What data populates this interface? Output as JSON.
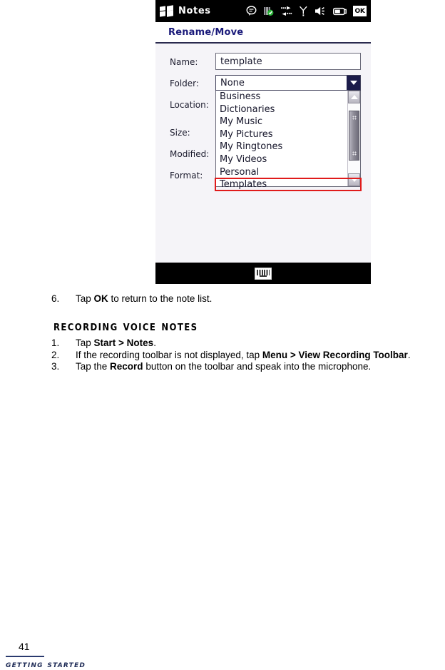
{
  "device": {
    "titlebar": {
      "logo": "windows-flag-logo",
      "app_name": "Notes",
      "icons": [
        {
          "name": "messaging-icon",
          "glyph": "speech-bubble"
        },
        {
          "name": "signal-bars-icon",
          "glyph": "bars-with-check"
        },
        {
          "name": "data-connection-icon",
          "glyph": "two-arrows"
        },
        {
          "name": "phone-signal-icon",
          "glyph": "antenna"
        },
        {
          "name": "volume-icon",
          "glyph": "speaker"
        },
        {
          "name": "battery-icon",
          "glyph": "battery"
        }
      ],
      "ok_label": "OK"
    },
    "page_title": "Rename/Move",
    "fields": [
      {
        "label": "Name:"
      },
      {
        "label": "Folder:"
      },
      {
        "label": "Location:"
      },
      {
        "label": "Size:"
      },
      {
        "label": "Modified:"
      },
      {
        "label": "Format:"
      }
    ],
    "name_value": "template",
    "name_placeholder": "",
    "folder_selected": "None",
    "folder_options": [
      "Business",
      "Dictionaries",
      "My Music",
      "My Pictures",
      "My Ringtones",
      "My Videos",
      "Personal",
      "Templates"
    ],
    "highlighted_option": "Templates",
    "highlight_color": "#e01b1b",
    "softbar": {
      "keyboard_icon": "keyboard-icon"
    },
    "colors": {
      "title_text": "#1a1a7a",
      "screen_bg": "#f5f4f8",
      "titlebar_bg": "#000000"
    }
  },
  "document": {
    "step6": {
      "number": "6.",
      "text_before": "Tap ",
      "bold": "OK",
      "text_after": " to return to the note list."
    },
    "heading": "Recording Voice Notes",
    "steps": [
      {
        "number": "1.",
        "parts": [
          {
            "t": "Tap ",
            "b": false
          },
          {
            "t": "Start > Notes",
            "b": true
          },
          {
            "t": ".",
            "b": false
          }
        ]
      },
      {
        "number": "2.",
        "parts": [
          {
            "t": "If the recording toolbar is not displayed, tap ",
            "b": false
          },
          {
            "t": "Menu > View Recording Toolbar",
            "b": true
          },
          {
            "t": ".",
            "b": false
          }
        ]
      },
      {
        "number": "3.",
        "parts": [
          {
            "t": "Tap the ",
            "b": false
          },
          {
            "t": "Record",
            "b": true
          },
          {
            "t": " button on the toolbar and speak into the microphone.",
            "b": false
          }
        ]
      }
    ],
    "footer": {
      "page_number": "41",
      "section_title": "Getting Started",
      "rule_color": "#2a3a6e"
    }
  }
}
